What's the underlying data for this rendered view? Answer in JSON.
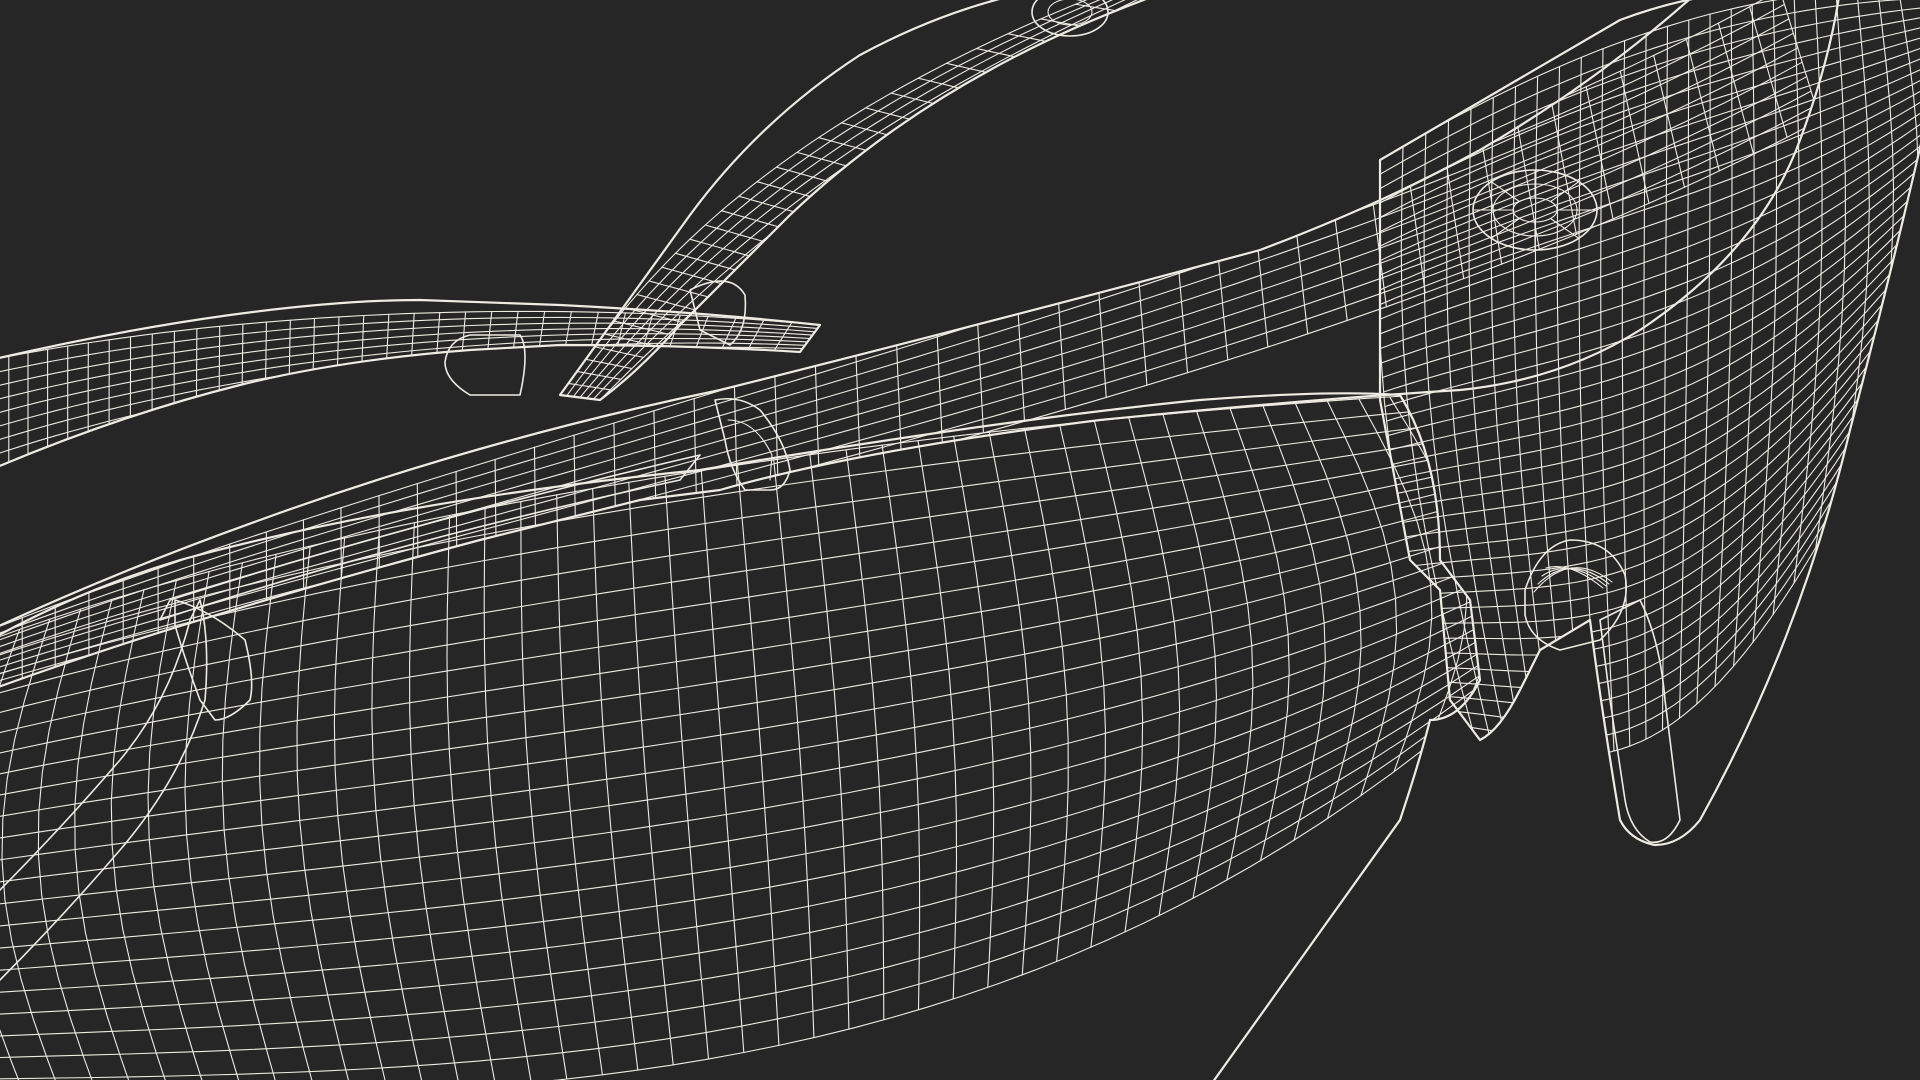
{
  "scene": {
    "subject": "safety-glasses-wireframe",
    "colors": {
      "background": "#262626",
      "surface": "#7b7b6f",
      "surface_light": "#8a8a7e",
      "surface_dark": "#66665b",
      "wire": "#eeece2",
      "shadow": "#4f4f46"
    }
  }
}
